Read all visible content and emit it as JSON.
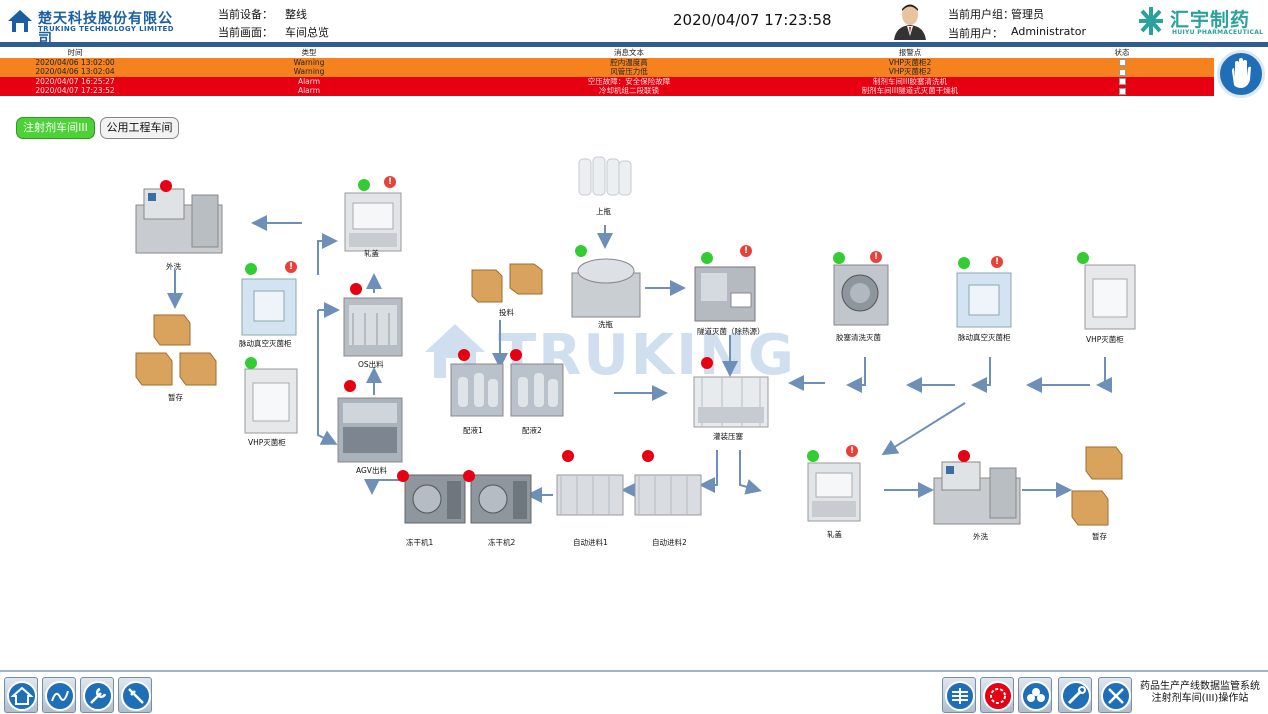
{
  "header": {
    "company_name": "楚天科技股份有限公司",
    "company_name_en": "TRUKING TECHNOLOGY LIMITED",
    "current_device_label": "当前设备：",
    "current_device_value": "整线",
    "current_screen_label": "当前画面：",
    "current_screen_value": "车间总览",
    "datetime": "2020/04/07 17:23:58",
    "user_group_label": "当前用户组：",
    "user_group_value": "管理员",
    "user_label": "当前用户：",
    "user_value": "Administrator",
    "brand_name": "汇宇制药",
    "brand_name_en": "HUIYU PHARMACEUTICAL"
  },
  "alarm_table": {
    "columns": [
      "时间",
      "类型",
      "消息文本",
      "报警点",
      "状态"
    ],
    "rows": [
      {
        "time": "2020/04/06 13:02:00",
        "type": "Warning",
        "message": "腔内温度高",
        "point": "VHP灭菌柜2",
        "level": "warning"
      },
      {
        "time": "2020/04/06 13:02:04",
        "type": "Warning",
        "message": "风管压力低",
        "point": "VHP灭菌柜2",
        "level": "warning"
      },
      {
        "time": "2020/04/07 16:25:27",
        "type": "Alarm",
        "message": "空压故障：安全保险故障",
        "point": "制剂车间III胶塞清洗机",
        "level": "alarm"
      },
      {
        "time": "2020/04/07 17:23:52",
        "type": "Alarm",
        "message": "冷却机组二段联锁",
        "point": "制剂车间III隧道式灭菌干燥机",
        "level": "alarm"
      }
    ]
  },
  "tabs": [
    "注射剂车间III",
    "公用工程车间"
  ],
  "diagram": {
    "watermark": "TRUKING",
    "labels": {
      "waixi_left": "外洗",
      "zancun_left": "暂存",
      "zhahe_top": "轧盖",
      "maidong_left": "脉动真空灭菌柜",
      "vhp_left": "VHP灭菌柜",
      "os_chuliao": "OS出料",
      "agv_chuliao": "AGV出料",
      "dongganji1": "冻干机1",
      "dongganji2": "冻干机2",
      "touliao": "投料",
      "peiye1": "配液1",
      "peiye2": "配液2",
      "shangping": "上瓶",
      "xiping": "洗瓶",
      "suidao": "隧道灭菌（除热源）",
      "jiaosai": "胶塞清洗灭菌",
      "maidong_right": "脉动真空灭菌柜",
      "vhp_right": "VHP灭菌柜",
      "guanzhuang": "灌装压塞",
      "zidong1": "自动进料1",
      "zidong2": "自动进料2",
      "zhahe_right": "轧盖",
      "waixi_right": "外洗",
      "zancun_right": "暂存"
    }
  },
  "footer": {
    "system_title_line1": "药品生产产线数据监管系统",
    "system_title_line2": "注射剂车间(III)操作站"
  },
  "colors": {
    "warning_row": "#f5821f",
    "alarm_row": "#e60012",
    "status_ok": "#33cc33",
    "status_fault": "#e60012",
    "header_bar": "#2f5d93",
    "tab_active": "#4cd137"
  }
}
